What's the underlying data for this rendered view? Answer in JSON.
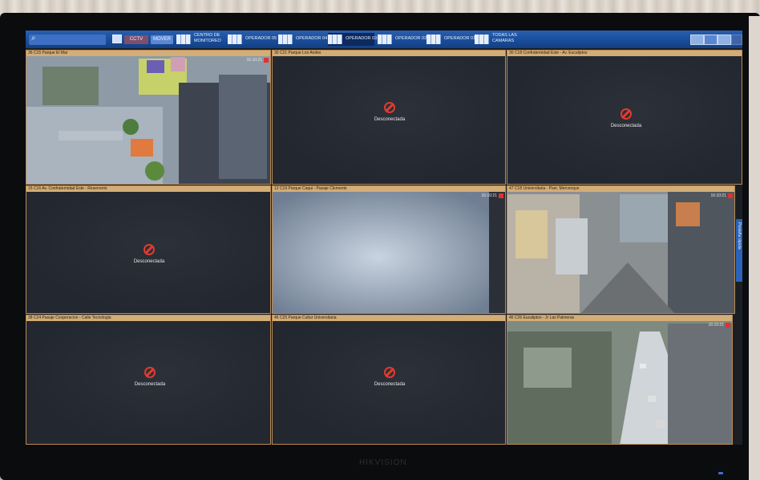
{
  "toolbar": {
    "search_placeholder": "",
    "btn1_label": "CCTV",
    "btn2_label": "MOVER",
    "tabs": [
      {
        "label": "CENTRO DE\nMONITOREO"
      },
      {
        "label": "OPERADOR 05"
      },
      {
        "label": "OPERADOR 04"
      },
      {
        "label": "OPERADOR 03"
      },
      {
        "label": "OPERADOR 02"
      },
      {
        "label": "OPERADOR 01"
      },
      {
        "label": "TODAS LAS\nCAMARAS"
      }
    ]
  },
  "cells": [
    {
      "title": "36 C15 Parque El Mar",
      "time": "16:10:21",
      "status": ""
    },
    {
      "title": "30 C21 Parque Los Andes",
      "time": "",
      "status": "Desconectada"
    },
    {
      "title": "30 C18 Confraternidad Este - Av. Eucaliptos",
      "time": "",
      "status": "Desconectada"
    },
    {
      "title": "15 C16 Av. Confraternidad Este - Reservorio",
      "time": "",
      "status": "Desconectada"
    },
    {
      "title": "12 C19 Parque Caqui - Pasaje Clemente",
      "time": "16:10:21",
      "status": ""
    },
    {
      "title": "47 C18 Universitaria - Pser. Mercenqun",
      "time": "16:10:21",
      "status": ""
    },
    {
      "title": "38 C24 Pasaje Cooperacion - Calle Tecnologia",
      "time": "",
      "status": "Desconectada"
    },
    {
      "title": "46 C25 Parque Cultur Universitaria",
      "time": "",
      "status": "Desconectada"
    },
    {
      "title": "46 C26 Eucaliptos - Jr Las Palmeras",
      "time": "16:10:21",
      "status": ""
    }
  ],
  "side_tab": "Pestaña rápida",
  "brand": "HIKVISION"
}
